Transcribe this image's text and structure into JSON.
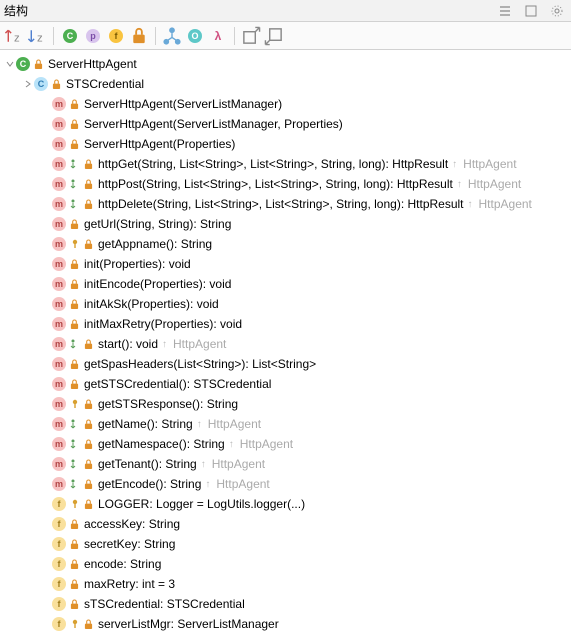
{
  "header": {
    "title": "结构"
  },
  "toolbar": {
    "c_label": "C",
    "p_label": "p",
    "f_label": "f",
    "lock_label": "🔒",
    "i_label": "I",
    "o_label": "O",
    "lambda": "λ"
  },
  "tree": {
    "root": {
      "name": "ServerHttpAgent",
      "kind": "c"
    },
    "items": [
      {
        "kind": "c-inner",
        "lock": true,
        "name": "STSCredential",
        "expandable": true,
        "indent": 1
      },
      {
        "kind": "m",
        "lock": true,
        "name": "ServerHttpAgent(ServerListManager)"
      },
      {
        "kind": "m",
        "lock": true,
        "name": "ServerHttpAgent(ServerListManager, Properties)"
      },
      {
        "kind": "m",
        "lock": true,
        "name": "ServerHttpAgent(Properties)"
      },
      {
        "kind": "m",
        "lock": true,
        "name": "httpGet(String, List<String>, List<String>, String, long): HttpResult",
        "override": true,
        "hint": "HttpAgent"
      },
      {
        "kind": "m",
        "lock": true,
        "name": "httpPost(String, List<String>, List<String>, String, long): HttpResult",
        "override": true,
        "hint": "HttpAgent"
      },
      {
        "kind": "m",
        "lock": true,
        "name": "httpDelete(String, List<String>, List<String>, String, long): HttpResult",
        "override": true,
        "hint": "HttpAgent"
      },
      {
        "kind": "m",
        "lock": true,
        "name": "getUrl(String, String): String"
      },
      {
        "kind": "m",
        "lock": true,
        "pin": true,
        "name": "getAppname(): String"
      },
      {
        "kind": "m",
        "lock": true,
        "name": "init(Properties): void"
      },
      {
        "kind": "m",
        "lock": true,
        "name": "initEncode(Properties): void"
      },
      {
        "kind": "m",
        "lock": true,
        "name": "initAkSk(Properties): void"
      },
      {
        "kind": "m",
        "lock": true,
        "name": "initMaxRetry(Properties): void"
      },
      {
        "kind": "m",
        "lock": true,
        "name": "start(): void",
        "override": true,
        "hint": "HttpAgent"
      },
      {
        "kind": "m",
        "lock": true,
        "name": "getSpasHeaders(List<String>): List<String>"
      },
      {
        "kind": "m",
        "lock": true,
        "name": "getSTSCredential(): STSCredential"
      },
      {
        "kind": "m",
        "lock": true,
        "pin": true,
        "name": "getSTSResponse(): String"
      },
      {
        "kind": "m",
        "lock": true,
        "name": "getName(): String",
        "override": true,
        "hint": "HttpAgent"
      },
      {
        "kind": "m",
        "lock": true,
        "name": "getNamespace(): String",
        "override": true,
        "hint": "HttpAgent"
      },
      {
        "kind": "m",
        "lock": true,
        "name": "getTenant(): String",
        "override": true,
        "hint": "HttpAgent"
      },
      {
        "kind": "m",
        "lock": true,
        "name": "getEncode(): String",
        "override": true,
        "hint": "HttpAgent"
      },
      {
        "kind": "f",
        "lock": true,
        "pin": true,
        "name": "LOGGER: Logger = LogUtils.logger(...)"
      },
      {
        "kind": "f",
        "lock": true,
        "name": "accessKey: String"
      },
      {
        "kind": "f",
        "lock": true,
        "name": "secretKey: String"
      },
      {
        "kind": "f",
        "lock": true,
        "name": "encode: String"
      },
      {
        "kind": "f",
        "lock": true,
        "name": "maxRetry: int = 3"
      },
      {
        "kind": "f",
        "lock": true,
        "name": "sTSCredential: STSCredential"
      },
      {
        "kind": "f",
        "lock": true,
        "pin": true,
        "name": "serverListMgr: ServerListManager"
      }
    ]
  }
}
